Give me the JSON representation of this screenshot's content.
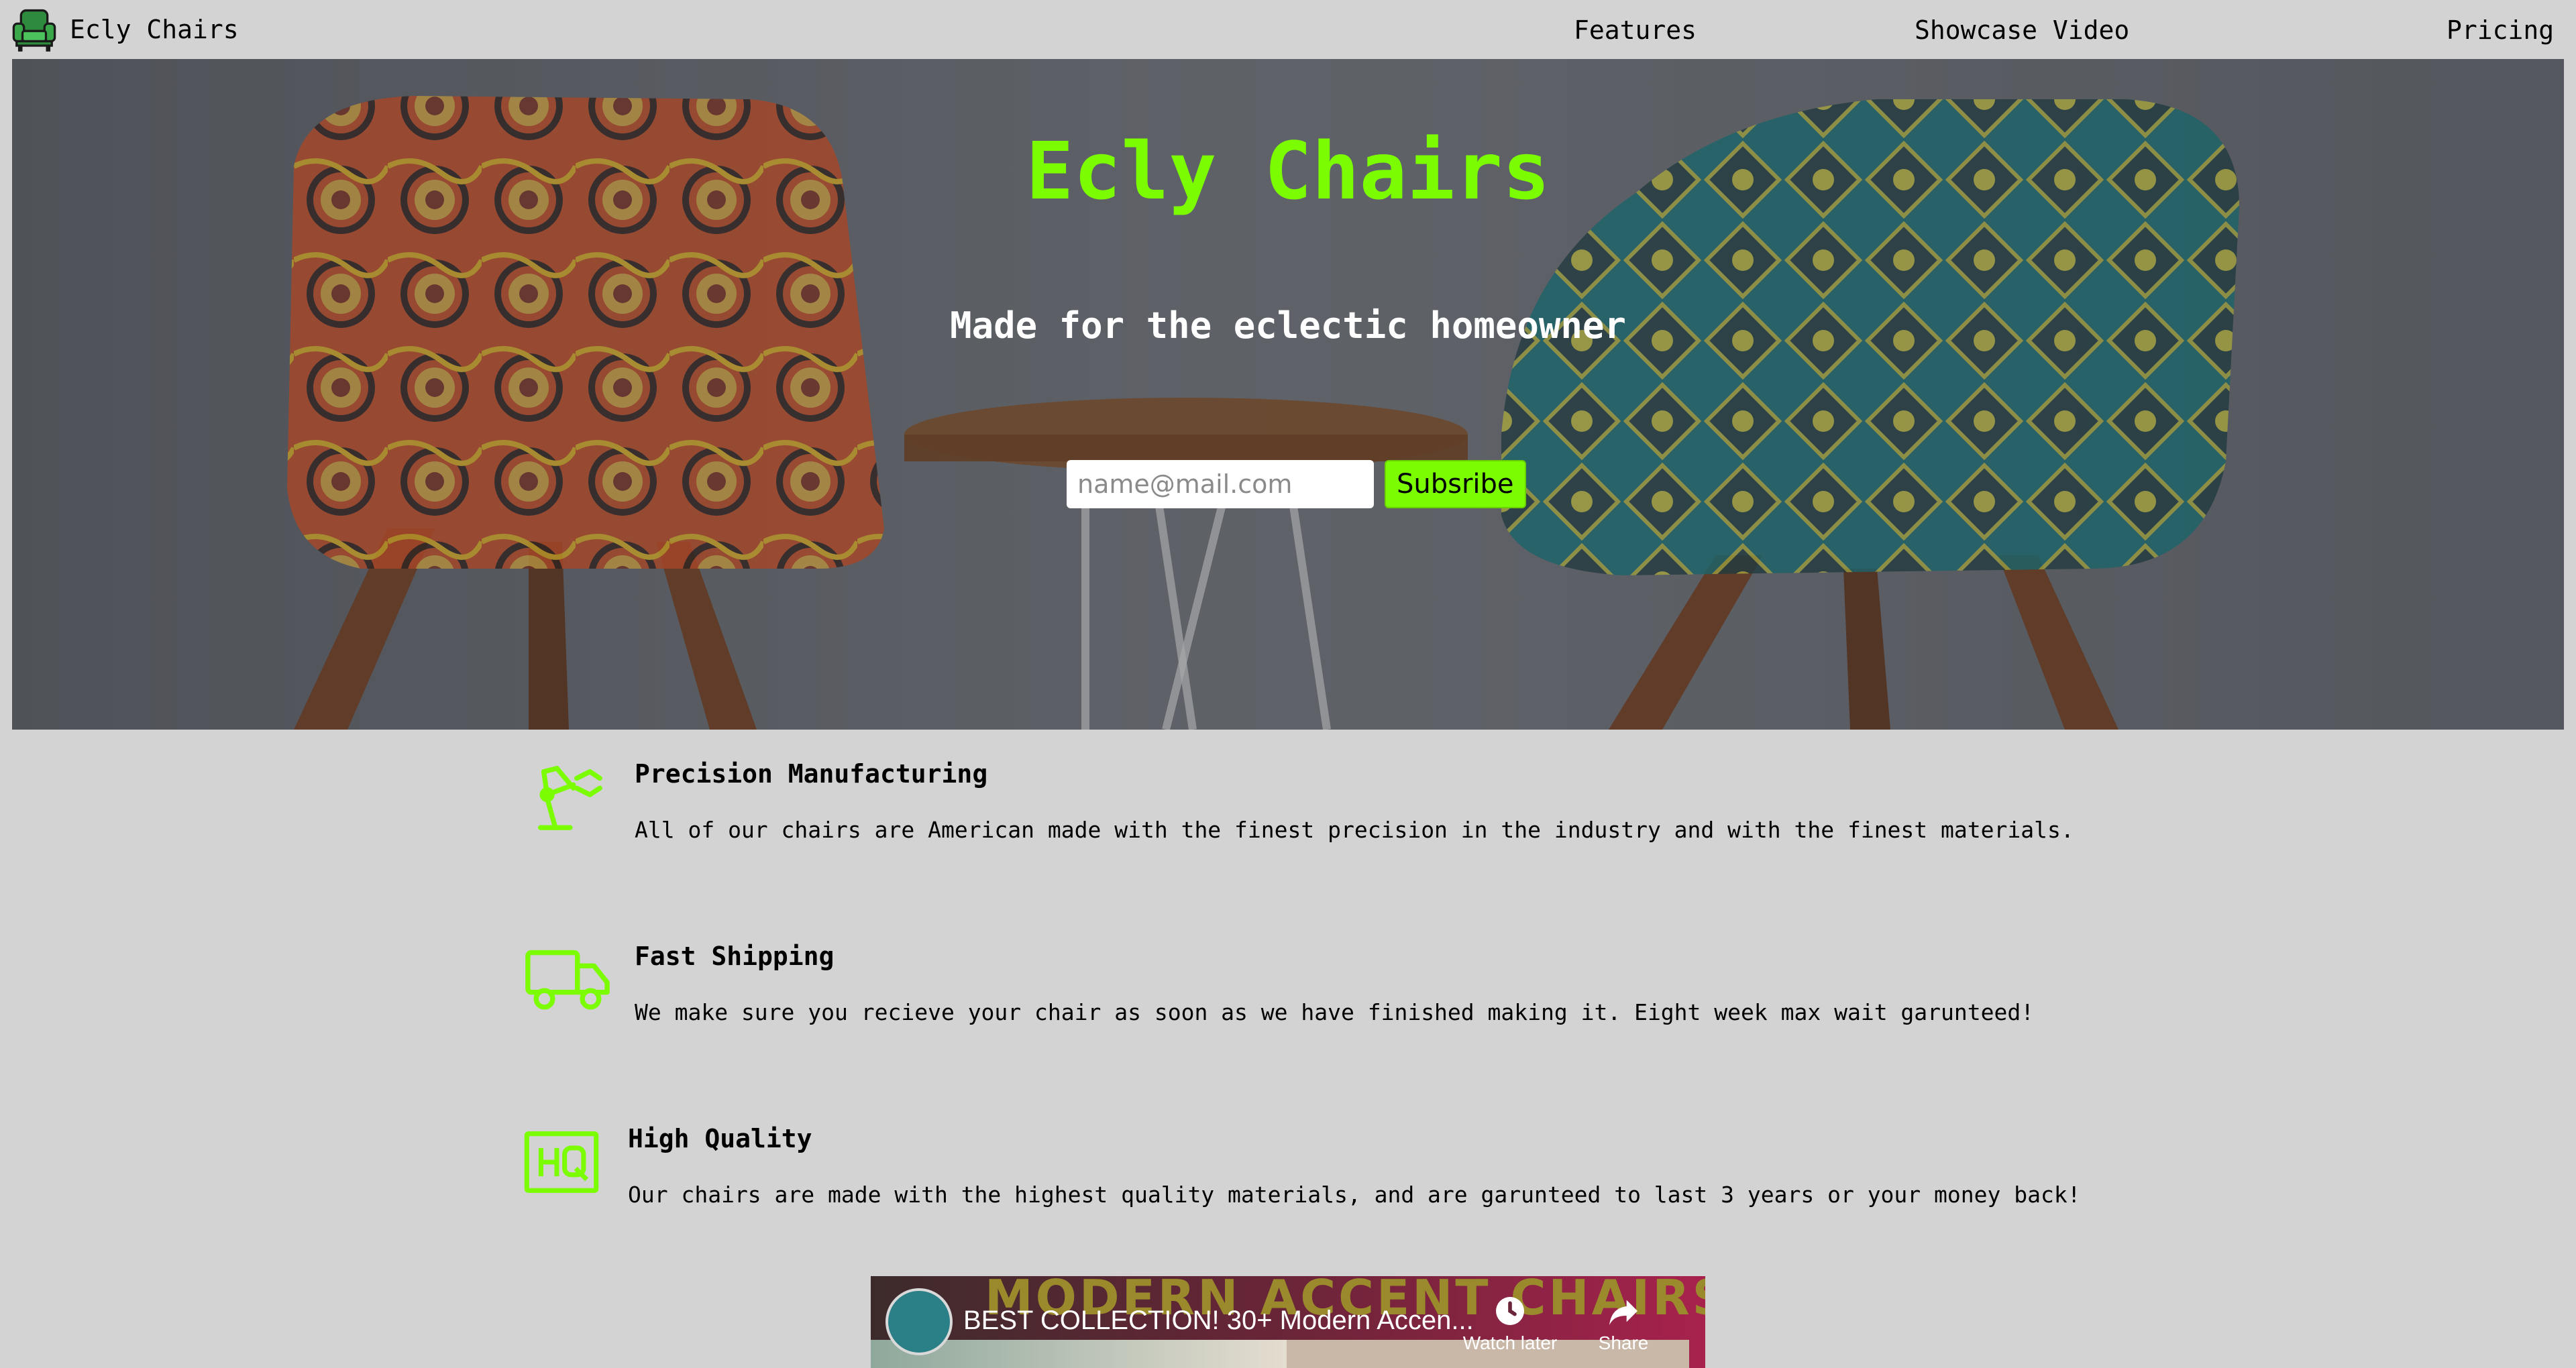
{
  "nav": {
    "brand": "Ecly Chairs",
    "links": [
      {
        "label": "Features"
      },
      {
        "label": "Showcase Video"
      },
      {
        "label": "Pricing"
      }
    ]
  },
  "hero": {
    "title": "Ecly Chairs",
    "subtitle": "Made for the eclectic homeowner",
    "email_placeholder": "name@mail.com",
    "subscribe_label": "Subsribe"
  },
  "features": [
    {
      "icon": "robot-arm-icon",
      "title": "Precision Manufacturing",
      "text": "All of our chairs are American made with the finest precision in the industry and with the finest materials."
    },
    {
      "icon": "truck-icon",
      "title": "Fast Shipping",
      "text": "We make sure you recieve your chair as soon as we have finished making it. Eight week max wait garunteed!"
    },
    {
      "icon": "hq-icon",
      "title": "High Quality",
      "text": "Our chairs are made with the highest quality materials, and are garunteed to last 3 years or your money back!"
    }
  ],
  "video": {
    "banner_text": "MODERN ACCENT CHAIRS",
    "title": "BEST COLLECTION! 30+ Modern Accen...",
    "watch_later_label": "Watch later",
    "share_label": "Share"
  },
  "colors": {
    "accent": "#7cfc00",
    "background": "#d3d3d3"
  }
}
